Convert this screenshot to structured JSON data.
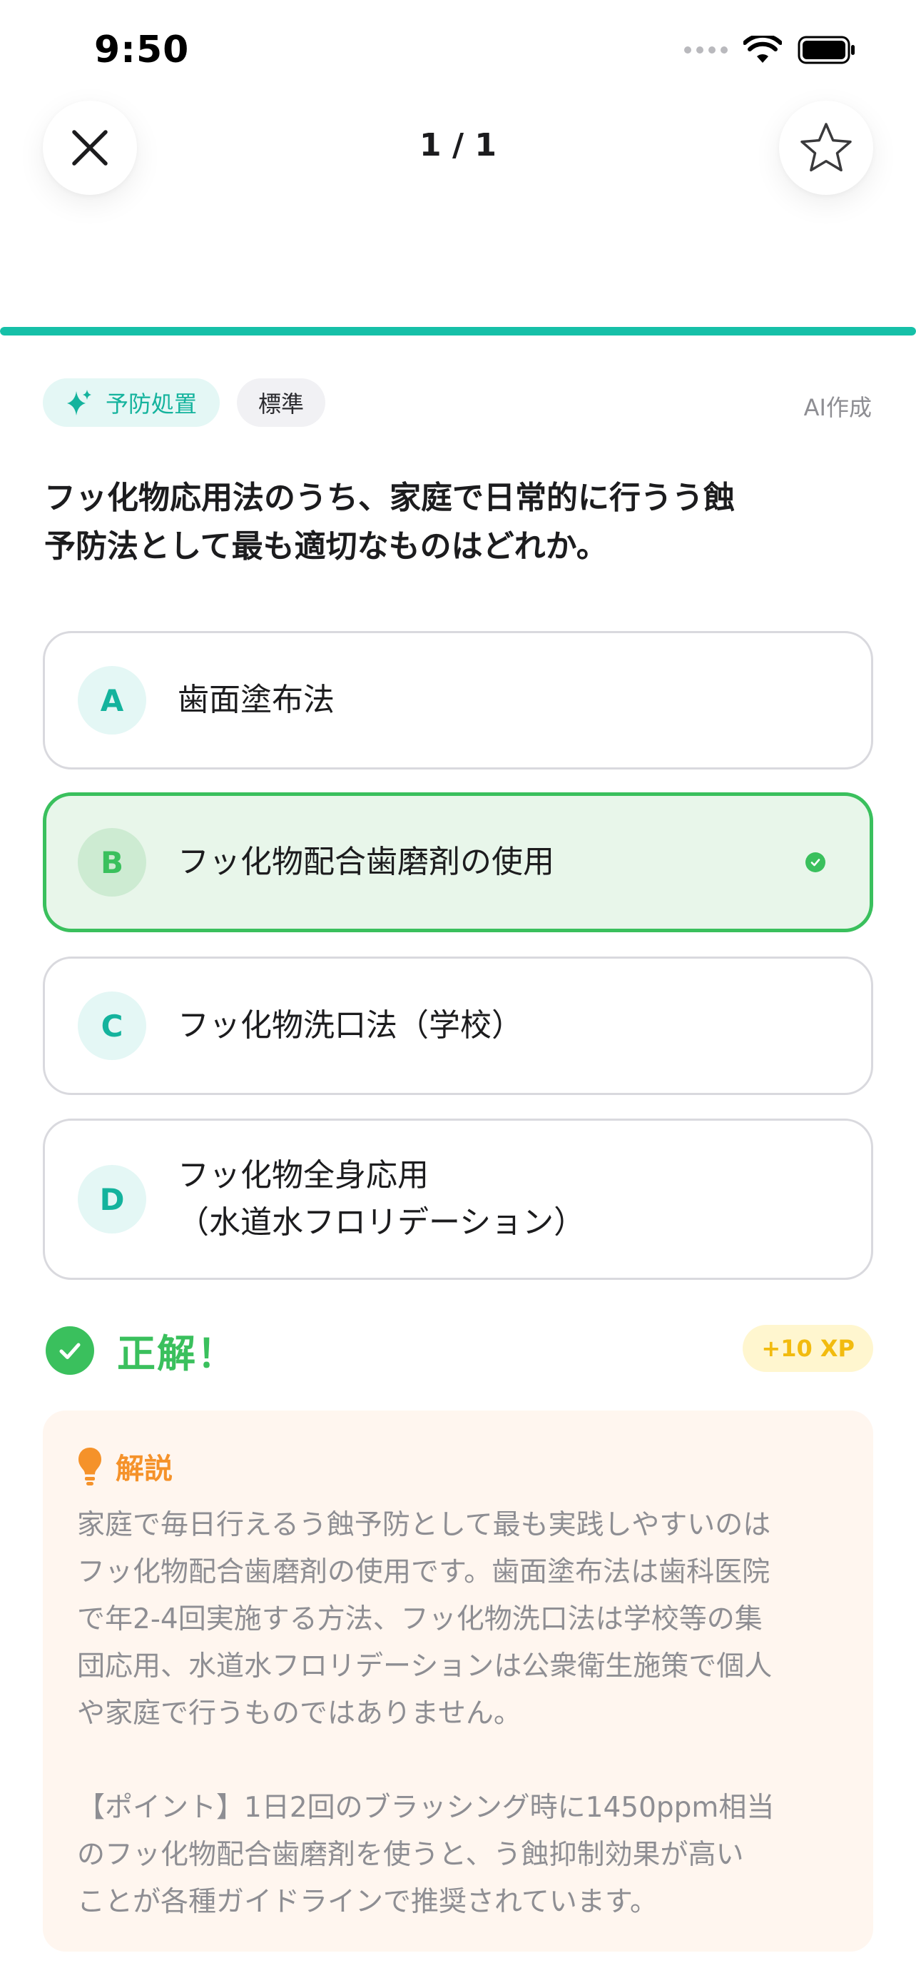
{
  "status_bar": {
    "time": "9:50"
  },
  "header": {
    "counter": "1 / 1",
    "close_icon": "close-icon",
    "bookmark_icon": "star-outline-icon"
  },
  "progress": {
    "fraction": 1.0,
    "color": "#16c0a8"
  },
  "tags": {
    "category": "予防処置",
    "category_icon": "sparkle-icon",
    "level": "標準",
    "source": "AI作成"
  },
  "question": {
    "line1": "フッ化物応用法のうち、家庭で日常的に行うう蝕",
    "line2": "予防法として最も適切なものはどれか。"
  },
  "options": [
    {
      "letter": "A",
      "line1": "歯面塗布法",
      "line2": ""
    },
    {
      "letter": "B",
      "line1": "フッ化物配合歯磨剤の使用",
      "line2": "",
      "selected": true
    },
    {
      "letter": "C",
      "line1": "フッ化物洗口法（学校）",
      "line2": ""
    },
    {
      "letter": "D",
      "line1": "フッ化物全身応用",
      "line2": "（水道水フロリデーション）"
    }
  ],
  "result": {
    "label": "正解！",
    "xp": "+10 XP",
    "color": "#3ac05d"
  },
  "explanation": {
    "title": "解説",
    "icon": "lightbulb-icon",
    "para1_lines": [
      "家庭で毎日行えるう蝕予防として最も実践しやすいのは",
      "フッ化物配合歯磨剤の使用です。歯面塗布法は歯科医院",
      "で年2-4回実施する方法、フッ化物洗口法は学校等の集",
      "団応用、水道水フロリデーションは公衆衛生施策で個人",
      "や家庭で行うものではありません。"
    ],
    "para2_lines": [
      "【ポイント】1日2回のブラッシング時に1450ppm相当",
      "のフッ化物配合歯磨剤を使うと、う蝕抑制効果が高い",
      "ことが各種ガイドラインで推奨されています。"
    ]
  }
}
